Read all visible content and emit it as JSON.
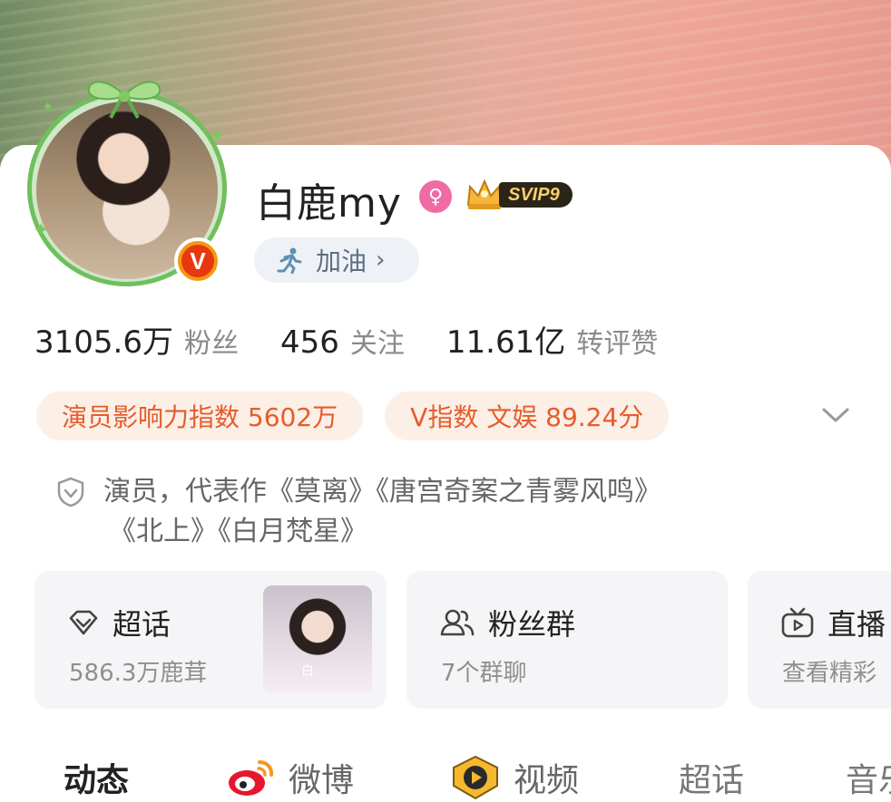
{
  "profile": {
    "name": "白鹿my",
    "svip_label": "SVIP9",
    "status": "加油",
    "status_chevron": "›",
    "verified_badge": "V"
  },
  "stats": [
    {
      "value": "3105.6万",
      "label": "粉丝"
    },
    {
      "value": "456",
      "label": "关注"
    },
    {
      "value": "11.61亿",
      "label": "转评赞"
    }
  ],
  "chips": [
    "演员影响力指数 5602万",
    "V指数 文娱 89.24分"
  ],
  "bio": {
    "line1": "演员，代表作《莫离》《唐宫奇案之青雾风鸣》",
    "line2": "《北上》《白月梵星》"
  },
  "cards": [
    {
      "title": "超话",
      "subtitle": "586.3万鹿茸",
      "icon": "diamond-icon",
      "thumb_mark": "白"
    },
    {
      "title": "粉丝群",
      "subtitle": "7个群聊",
      "icon": "group-icon"
    },
    {
      "title": "直播",
      "subtitle": "查看精彩",
      "icon": "tv-icon"
    }
  ],
  "tabs": [
    {
      "label": "动态",
      "active": true
    },
    {
      "label": "微博",
      "icon": "weibo-icon"
    },
    {
      "label": "视频",
      "icon": "video-icon"
    },
    {
      "label": "超话"
    },
    {
      "label": "音乐"
    }
  ],
  "colors": {
    "accent_orange": "#e65c2c",
    "chip_bg": "#fbefe6",
    "card_bg": "#f5f5f7",
    "avatar_ring": "#6fbf5e",
    "gender_pink": "#f06ba3"
  }
}
